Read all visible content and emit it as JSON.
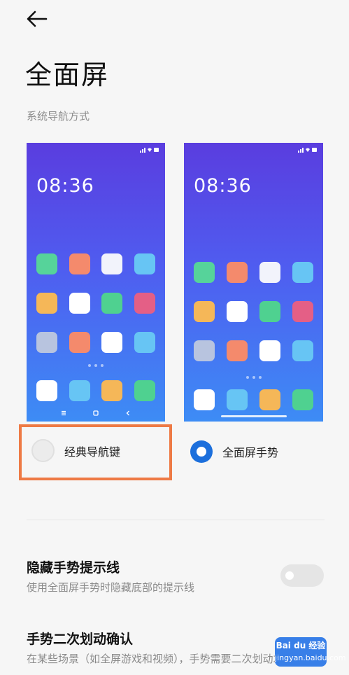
{
  "header": {
    "title": "全面屏"
  },
  "nav_section": {
    "label": "系统导航方式",
    "classic_preview": {
      "clock": "08:36",
      "app_colors": [
        "#56d39a",
        "#f48a6c",
        "#f2f3fb",
        "#67c5f4",
        "#f5b758",
        "#ffffff",
        "#4fd190",
        "#e45f86",
        "#b8c4df",
        "#f48a6c",
        "#ffffff",
        "#67c5f4"
      ],
      "dock_colors": [
        "#ffffff",
        "#67c5f4",
        "#f5b758",
        "#4fd190"
      ],
      "nav_keys": {
        "menu": "≡",
        "home": "▢",
        "back": "‹"
      }
    },
    "gesture_preview": {
      "clock": "08:36",
      "app_colors": [
        "#56d39a",
        "#f48a6c",
        "#f2f3fb",
        "#67c5f4",
        "#f5b758",
        "#ffffff",
        "#4fd190",
        "#e45f86",
        "#b8c4df",
        "#f48a6c",
        "#ffffff",
        "#67c5f4"
      ],
      "dock_colors": [
        "#ffffff",
        "#67c5f4",
        "#f5b758",
        "#4fd190"
      ]
    },
    "options": [
      {
        "label": "经典导航键",
        "selected": false
      },
      {
        "label": "全面屏手势",
        "selected": true
      }
    ],
    "highlight_color": "#ee7a45",
    "accent_color": "#1c6fdc"
  },
  "settings": {
    "hide_gesture_line": {
      "title": "隐藏手势提示线",
      "description": "使用全面屏手势时隐藏底部的提示线",
      "enabled": false
    },
    "second_swipe_confirm": {
      "title": "手势二次划动确认",
      "description": "在某些场景（如全屏游戏和视频），手势需要二次划动才生效"
    }
  },
  "watermark": {
    "logo": "Bai du 经验",
    "site": "jingyan.baidu.com"
  }
}
